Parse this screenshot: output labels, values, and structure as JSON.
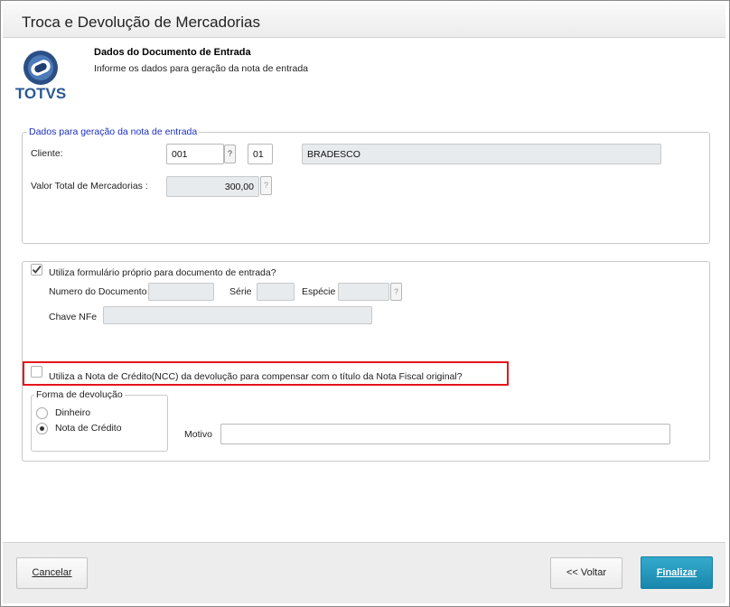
{
  "window": {
    "title": "Troca e Devolução de Mercadorias"
  },
  "header": {
    "logo_text": "TOTVS",
    "title": "Dados do Documento de Entrada",
    "subtitle": "Informe os dados para geração da nota de entrada"
  },
  "entry_section": {
    "legend": "Dados para geração da nota de entrada",
    "cliente_label": "Cliente:",
    "cliente_code": "001",
    "cliente_store": "01",
    "cliente_name": "BRADESCO",
    "valor_label": "Valor Total de Mercadorias :",
    "valor_value": "300,00",
    "lookup_glyph": "?"
  },
  "own_form": {
    "checkbox_label": "Utiliza formulário próprio para documento de entrada?",
    "checked": true,
    "numero_label": "Numero do Documento",
    "numero_value": "",
    "serie_label": "Série",
    "serie_value": "",
    "especie_label": "Espécie",
    "especie_value": "",
    "chave_label": "Chave NFe",
    "chave_value": ""
  },
  "ncc": {
    "checkbox_label": "Utiliza a Nota de Crédito(NCC) da devolução para compensar com o título da Nota Fiscal original?",
    "checked": false,
    "highlight_color": "#e3161b"
  },
  "devolucao": {
    "legend": "Forma de devolução",
    "options": [
      {
        "label": "Dinheiro",
        "selected": false
      },
      {
        "label": "Nota de Crédito",
        "selected": true
      }
    ],
    "motivo_label": "Motivo",
    "motivo_value": ""
  },
  "footer": {
    "cancel_label": "Cancelar",
    "back_label": "<< Voltar",
    "finish_label": "Finalizar",
    "accent_color": "#1e93bb"
  }
}
